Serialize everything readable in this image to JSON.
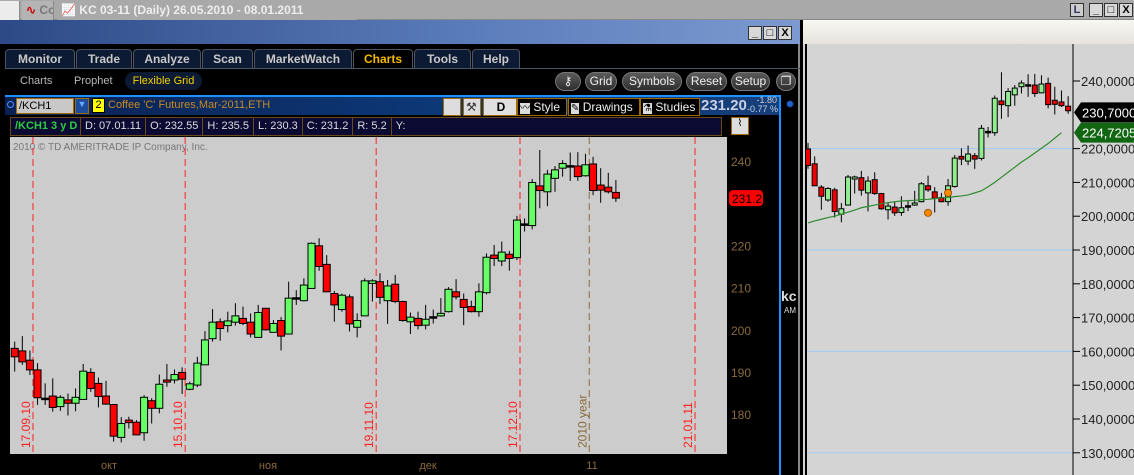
{
  "topbar": {
    "tab1_label": "Co",
    "title": "KC 03-11 (Daily)  26.05.2010 - 08.01.2011",
    "btn_l": "L",
    "btn_min": "_",
    "btn_max": "□",
    "btn_close": "X"
  },
  "left_window": {
    "btn_min": "_",
    "btn_max": "□",
    "btn_close": "X"
  },
  "main_tabs": [
    {
      "label": "Monitor"
    },
    {
      "label": "Trade"
    },
    {
      "label": "Analyze"
    },
    {
      "label": "Scan"
    },
    {
      "label": "MarketWatch"
    },
    {
      "label": "Charts",
      "active": true
    },
    {
      "label": "Tools"
    },
    {
      "label": "Help"
    }
  ],
  "sub_tabs": [
    {
      "label": "Charts"
    },
    {
      "label": "Prophet"
    },
    {
      "label": "Flexible Grid",
      "active": true
    }
  ],
  "toolbar": {
    "grid": "Grid",
    "symbols": "Symbols",
    "reset": "Reset",
    "setup": "Setup"
  },
  "chart_header": {
    "symbol": "/KCH1",
    "grid_num": "2",
    "description": "Coffee 'C' Futures,Mar-2011,ETH",
    "aggregation": "D",
    "style": "Style",
    "drawings": "Drawings",
    "studies": "Studies",
    "last": "231.20",
    "change": "-1.80",
    "change_pct": "-0.77 %"
  },
  "info": {
    "label": "/KCH1 3 y D",
    "date": "D: 07.01.11",
    "open": "O: 232.55",
    "high": "H: 235.5",
    "low": "L: 230.3",
    "close": "C: 231.2",
    "range": "R: 5.2",
    "y": "Y:"
  },
  "copyright": "2010 © TD AMERITRADE IP Company, Inc.",
  "colors": {
    "up": "#66ff66",
    "down": "#ff0000",
    "grid_line": "#ff2020",
    "year_line": "#8a6a3a",
    "axis_text": "#8a6a3a",
    "chart_bg": "#cccccc"
  },
  "side_text": {
    "a": "kc",
    "b": "AM"
  },
  "chart_data": [
    {
      "type": "candlestick",
      "price_axis": {
        "ticks": [
          180,
          190,
          200,
          210,
          220,
          230,
          240
        ]
      },
      "last_price_label": "231.2",
      "date_markers": [
        {
          "label": "17.09.10",
          "style": "red-dash"
        },
        {
          "label": "15.10.10",
          "style": "red-dash"
        },
        {
          "label": "19.11.10",
          "style": "red-dash"
        },
        {
          "label": "17.12.10",
          "style": "red-dash"
        },
        {
          "label": "2010 year",
          "style": "brown-dash"
        },
        {
          "label": "21.01.11",
          "style": "red-dash"
        }
      ],
      "month_labels": [
        "окт",
        "ноя",
        "дек",
        "11"
      ],
      "ohlc": [
        [
          195.6,
          197.2,
          190.1,
          193.6
        ],
        [
          195.0,
          198.5,
          191.7,
          192.4
        ],
        [
          192.8,
          195.1,
          189.3,
          190.5
        ],
        [
          190.5,
          192.1,
          182.2,
          183.9
        ],
        [
          183.8,
          187.3,
          182.2,
          183.8
        ],
        [
          184.3,
          188.5,
          180.6,
          181.6
        ],
        [
          181.8,
          184.5,
          180.8,
          184.0
        ],
        [
          183.4,
          184.9,
          179.7,
          182.6
        ],
        [
          182.6,
          186.1,
          180.7,
          184.0
        ],
        [
          183.5,
          191.9,
          183.4,
          190.2
        ],
        [
          189.9,
          190.9,
          185.3,
          186.1
        ],
        [
          187.3,
          188.7,
          181.6,
          184.2
        ],
        [
          184.3,
          187.9,
          182.2,
          182.4
        ],
        [
          182.3,
          182.4,
          173.5,
          174.8
        ],
        [
          174.5,
          179.3,
          173.3,
          177.8
        ],
        [
          178.6,
          179.4,
          176.6,
          178.0
        ],
        [
          178.1,
          178.6,
          175.1,
          175.1
        ],
        [
          175.6,
          184.5,
          173.7,
          184.0
        ],
        [
          183.2,
          183.8,
          177.8,
          181.4
        ],
        [
          181.4,
          189.4,
          180.2,
          187.1
        ],
        [
          188.1,
          191.9,
          186.5,
          187.6
        ],
        [
          188.1,
          190.6,
          187.3,
          189.4
        ],
        [
          189.9,
          191.1,
          184.8,
          188.3
        ],
        [
          185.9,
          187.7,
          185.7,
          187.2
        ],
        [
          186.9,
          193.6,
          186.4,
          192.1
        ],
        [
          191.7,
          199.7,
          191.7,
          197.6
        ],
        [
          197.9,
          204.9,
          197.2,
          201.8
        ],
        [
          201.9,
          202.7,
          197.4,
          200.3
        ],
        [
          201.0,
          204.3,
          199.4,
          202.1
        ],
        [
          201.8,
          206.3,
          201.0,
          203.3
        ],
        [
          202.7,
          205.5,
          201.1,
          201.5
        ],
        [
          201.8,
          203.9,
          198.2,
          199.0
        ],
        [
          198.2,
          205.9,
          198.2,
          204.1
        ],
        [
          205.1,
          205.1,
          199.8,
          200.0
        ],
        [
          199.4,
          202.3,
          199.4,
          201.5
        ],
        [
          202.2,
          203.0,
          195.1,
          198.5
        ],
        [
          199.0,
          211.4,
          199.0,
          207.5
        ],
        [
          207.6,
          209.4,
          205.9,
          207.6
        ],
        [
          206.9,
          212.2,
          206.7,
          210.6
        ],
        [
          209.8,
          220.7,
          209.8,
          220.5
        ],
        [
          219.9,
          221.7,
          214.0,
          215.0
        ],
        [
          215.5,
          217.7,
          209.0,
          209.0
        ],
        [
          208.6,
          209.2,
          201.9,
          205.9
        ],
        [
          204.8,
          208.6,
          204.3,
          208.2
        ],
        [
          207.8,
          208.4,
          199.6,
          201.4
        ],
        [
          200.6,
          203.9,
          198.2,
          202.2
        ],
        [
          203.3,
          212.2,
          203.3,
          211.6
        ],
        [
          211.0,
          212.0,
          206.7,
          211.6
        ],
        [
          211.4,
          213.4,
          206.1,
          207.7
        ],
        [
          206.9,
          211.8,
          201.4,
          210.4
        ],
        [
          210.8,
          213.0,
          206.3,
          206.7
        ],
        [
          206.7,
          206.9,
          201.9,
          202.2
        ],
        [
          201.9,
          204.1,
          199.0,
          203.0
        ],
        [
          202.7,
          204.3,
          200.1,
          201.0
        ],
        [
          201.1,
          205.9,
          200.1,
          202.5
        ],
        [
          203.1,
          204.8,
          201.5,
          203.1
        ],
        [
          203.3,
          207.5,
          203.1,
          203.9
        ],
        [
          204.3,
          210.1,
          204.1,
          209.6
        ],
        [
          209.0,
          212.0,
          207.2,
          207.8
        ],
        [
          207.2,
          208.6,
          201.1,
          205.3
        ],
        [
          205.5,
          206.9,
          204.1,
          204.3
        ],
        [
          204.3,
          211.0,
          203.1,
          209.0
        ],
        [
          208.8,
          218.1,
          208.4,
          217.2
        ],
        [
          217.7,
          220.1,
          215.1,
          216.9
        ],
        [
          216.3,
          220.9,
          215.1,
          218.4
        ],
        [
          217.9,
          218.7,
          214.0,
          216.9
        ],
        [
          217.1,
          227.0,
          216.5,
          226.0
        ],
        [
          225.1,
          226.4,
          223.3,
          225.1
        ],
        [
          224.7,
          235.7,
          223.8,
          234.9
        ],
        [
          234.1,
          242.6,
          228.8,
          233.0
        ],
        [
          232.7,
          237.9,
          229.3,
          236.9
        ],
        [
          235.9,
          238.8,
          232.7,
          237.9
        ],
        [
          238.3,
          240.2,
          236.3,
          239.4
        ],
        [
          238.9,
          242.0,
          235.3,
          238.9
        ],
        [
          238.8,
          242.1,
          235.3,
          236.3
        ],
        [
          236.5,
          241.7,
          236.3,
          239.1
        ],
        [
          239.3,
          241.0,
          231.9,
          233.0
        ],
        [
          234.3,
          238.3,
          230.1,
          233.1
        ],
        [
          233.8,
          237.2,
          232.3,
          232.7
        ],
        [
          232.55,
          235.5,
          230.3,
          231.2
        ]
      ]
    },
    {
      "type": "candlestick",
      "price_axis": {
        "ticks": [
          "240,0000",
          "220,0000",
          "210,0000",
          "200,0000",
          "190,0000",
          "180,0000",
          "170,0000",
          "160,0000",
          "150,0000",
          "140,0000",
          "130,0000"
        ]
      },
      "last_price_label": "230,7000",
      "ma_label": "224,7205",
      "ma_color": "#2e8b2e",
      "ma_values": [
        198,
        198.6,
        199.1,
        199.6,
        200,
        200.6,
        201.2,
        201.8,
        202.5,
        202.9,
        203.3,
        203.7,
        204,
        204.3,
        204.5,
        204.6,
        204.7,
        204.9,
        205,
        205.2,
        205.4,
        205.6,
        205.8,
        206,
        206.3,
        206.9,
        207.5,
        208.7,
        210,
        211.5,
        213,
        214.5,
        216,
        217.3,
        218.7,
        220.1,
        221.5,
        223.1,
        224.7
      ],
      "markers": [
        201,
        206.9
      ]
    }
  ]
}
